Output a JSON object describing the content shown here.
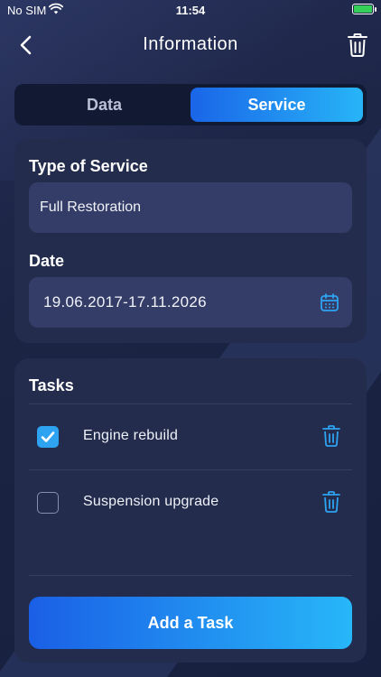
{
  "status_bar": {
    "carrier": "No SIM",
    "time": "11:54",
    "battery_color": "#34d058"
  },
  "nav": {
    "title": "Information",
    "back_icon": "chevron-left-icon",
    "delete_icon": "trash-icon"
  },
  "tabs": [
    {
      "label": "Data",
      "selected": false
    },
    {
      "label": "Service",
      "selected": true
    }
  ],
  "service": {
    "type_label": "Type of Service",
    "type_value": "Full Restoration",
    "date_label": "Date",
    "date_value": "19.06.2017-17.11.2026",
    "date_icon": "calendar-icon"
  },
  "tasks": {
    "heading": "Tasks",
    "items": [
      {
        "label": "Engine rebuild",
        "checked": true
      },
      {
        "label": "Suspension upgrade",
        "checked": false
      }
    ],
    "add_label": "Add a Task"
  },
  "colors": {
    "accent_start": "#1a65e8",
    "accent_end": "#27b5f7",
    "card": "#232c4c",
    "field": "#343d67",
    "icon_blue": "#2ea3f2"
  }
}
